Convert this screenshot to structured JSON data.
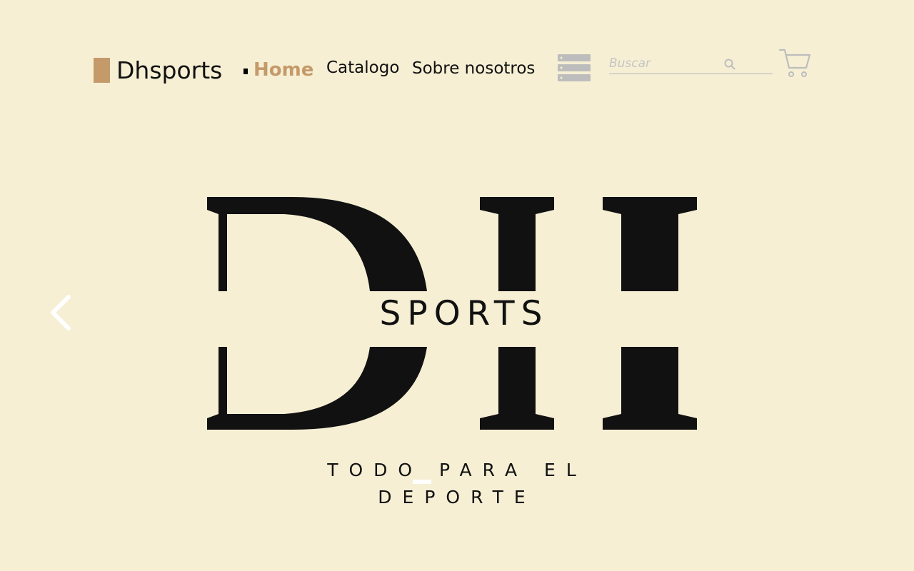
{
  "header": {
    "brand": "Dhsports",
    "nav": {
      "home": "Home",
      "catalogo": "Catalogo",
      "sobre": "Sobre nosotros"
    },
    "search": {
      "placeholder": "Buscar"
    },
    "icons": {
      "menu": "menu-stack-icon",
      "search": "search-icon",
      "cart": "cart-icon"
    }
  },
  "carousel": {
    "slide": {
      "logo_letters": "DH",
      "logo_word": "SPORTS",
      "tagline_line1": "TODO PARA EL",
      "tagline_line2": "DEPORTE"
    },
    "prev_icon": "chevron-left-icon"
  },
  "colors": {
    "background": "#f6efd4",
    "accent": "#c59a6a",
    "text": "#111111",
    "icon_gray": "#bdbdbd"
  }
}
